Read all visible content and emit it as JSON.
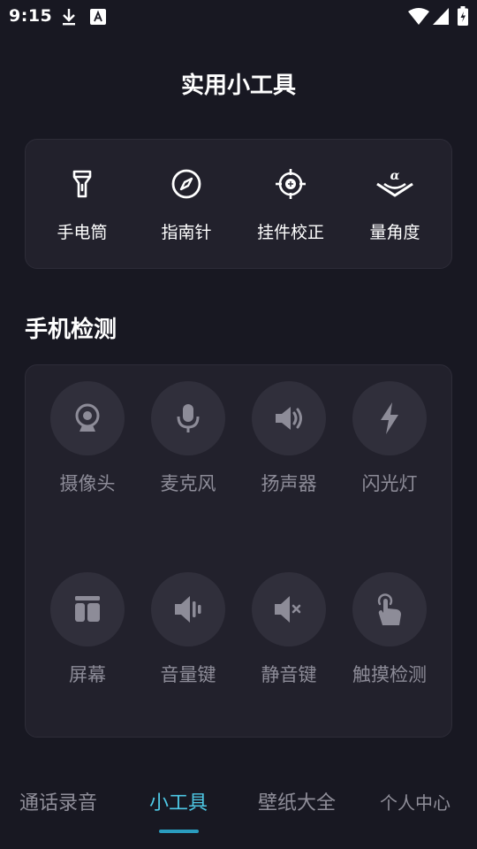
{
  "status_bar": {
    "time": "9:15",
    "icons": [
      "download-icon",
      "text-notification-icon",
      "wifi-icon",
      "signal-icon",
      "battery-icon"
    ]
  },
  "page_title": "实用小工具",
  "tools": [
    {
      "label": "手电筒",
      "icon": "flashlight-icon"
    },
    {
      "label": "指南针",
      "icon": "compass-icon"
    },
    {
      "label": "挂件校正",
      "icon": "crosshair-icon"
    },
    {
      "label": "量角度",
      "icon": "protractor-icon"
    }
  ],
  "section_title": "手机检测",
  "detections": [
    {
      "label": "摄像头",
      "icon": "camera-icon"
    },
    {
      "label": "麦克风",
      "icon": "microphone-icon"
    },
    {
      "label": "扬声器",
      "icon": "speaker-icon"
    },
    {
      "label": "闪光灯",
      "icon": "flash-icon"
    },
    {
      "label": "屏幕",
      "icon": "screen-icon"
    },
    {
      "label": "音量键",
      "icon": "volume-key-icon"
    },
    {
      "label": "静音键",
      "icon": "mute-key-icon"
    },
    {
      "label": "触摸检测",
      "icon": "touch-icon"
    }
  ],
  "bottom_nav": {
    "tabs": [
      {
        "label": "通话录音",
        "active": false
      },
      {
        "label": "小工具",
        "active": true
      },
      {
        "label": "壁纸大全",
        "active": false
      },
      {
        "label": "个人中心",
        "active": false
      }
    ]
  },
  "colors": {
    "background": "#181822",
    "card": "#22212c",
    "circle": "#302f3b",
    "muted_text": "#8d8c98",
    "accent": "#4ec9e6"
  }
}
